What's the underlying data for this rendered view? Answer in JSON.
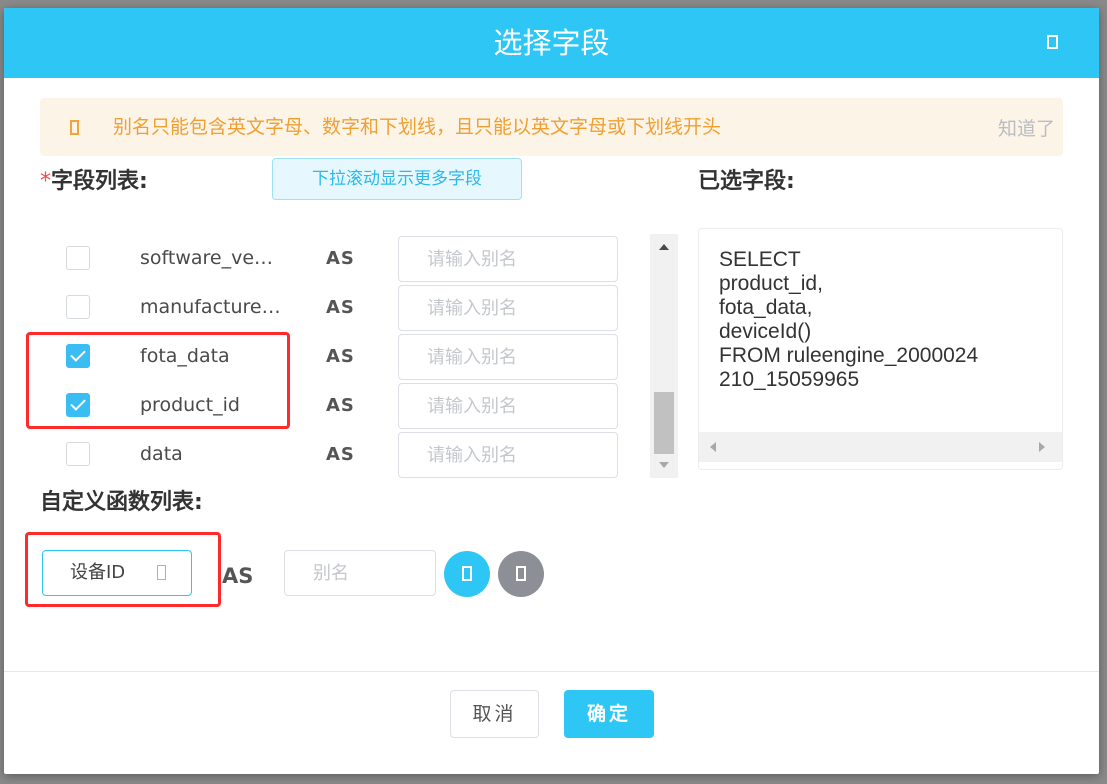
{
  "dialog": {
    "title": "选择字段",
    "close_icon": "close-icon"
  },
  "notice": {
    "icon": "warning-icon",
    "text": "别名只能包含英文字母、数字和下划线，且只能以英文字母或下划线开头",
    "dismiss_label": "知道了"
  },
  "field_section": {
    "required_mark": "*",
    "label": "字段列表:",
    "scroll_hint": "下拉滚动显示更多字段",
    "as_label": "AS",
    "alias_placeholder": "请输入别名",
    "fields": [
      {
        "name": "software_ve…",
        "checked": false
      },
      {
        "name": "manufacture…",
        "checked": false
      },
      {
        "name": "fota_data",
        "checked": true
      },
      {
        "name": "product_id",
        "checked": true
      },
      {
        "name": "data",
        "checked": false
      }
    ]
  },
  "selected_section": {
    "label": "已选字段:",
    "sql": "SELECT\nproduct_id,\nfota_data,\ndeviceId()\nFROM ruleengine_2000024\n210_15059965"
  },
  "function_section": {
    "label": "自定义函数列表:",
    "function_value": "设备ID",
    "as_label": "AS",
    "alias_placeholder": "别名",
    "add_icon": "add-icon",
    "remove_icon": "remove-icon"
  },
  "footer": {
    "cancel_label": "取消",
    "confirm_label": "确定"
  },
  "colors": {
    "accent": "#2ec6f5",
    "warning": "#f09f33",
    "highlight": "#ff2a2a"
  }
}
